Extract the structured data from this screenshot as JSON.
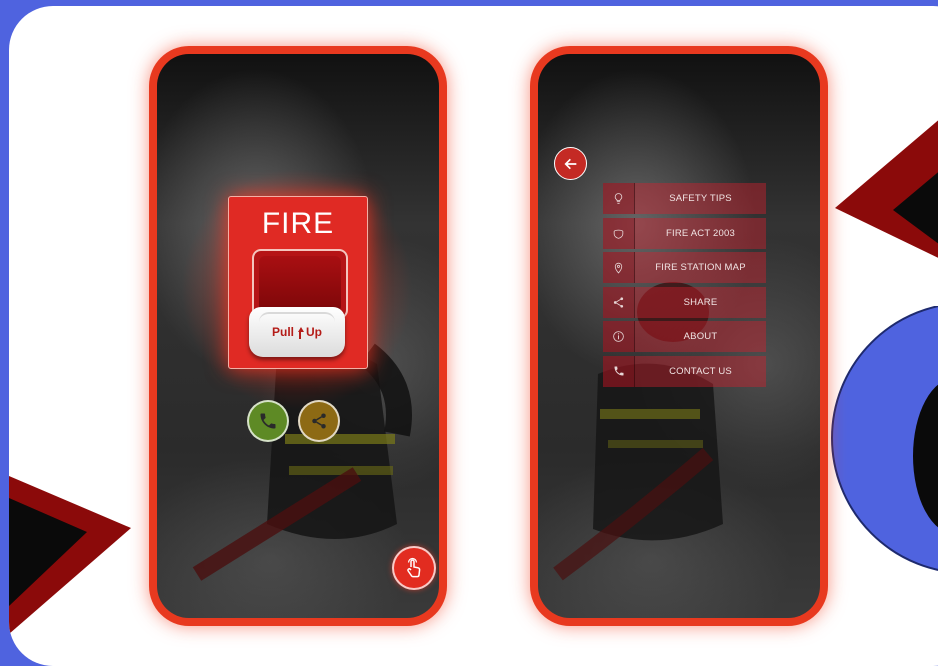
{
  "alarm": {
    "title": "FIRE",
    "pull_label_left": "Pull",
    "pull_label_right": "Up",
    "pull_icon": "arrow-up-icon"
  },
  "home_buttons": {
    "call_icon": "phone-icon",
    "share_icon": "share-icon",
    "touch_icon": "hand-tap-icon"
  },
  "menu": {
    "back_icon": "arrow-left-icon",
    "items": [
      {
        "label": "SAFETY TIPS",
        "icon": "lightbulb-icon"
      },
      {
        "label": "FIRE ACT 2003",
        "icon": "badge-icon"
      },
      {
        "label": "FIRE STATION MAP",
        "icon": "map-pin-icon"
      },
      {
        "label": "SHARE",
        "icon": "share-icon"
      },
      {
        "label": "ABOUT",
        "icon": "info-icon"
      },
      {
        "label": "CONTACT US",
        "icon": "phone-icon"
      }
    ]
  },
  "colors": {
    "background": "#4f63df",
    "phone_frame": "#e8391f",
    "alarm_red": "#e02a24",
    "menu_item": "#d71e2d",
    "decoration_dark_red": "#8b0a0a"
  }
}
